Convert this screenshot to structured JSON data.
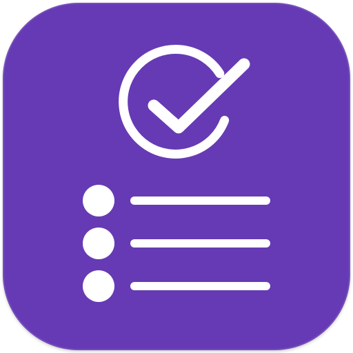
{
  "app_icon": {
    "name": "checklist-app-icon",
    "background_color": "#663ab4",
    "foreground_color": "#ffffff",
    "icons": {
      "check": "check-circle-icon",
      "list": "bulleted-list-icon"
    },
    "list_item_count": 3
  }
}
